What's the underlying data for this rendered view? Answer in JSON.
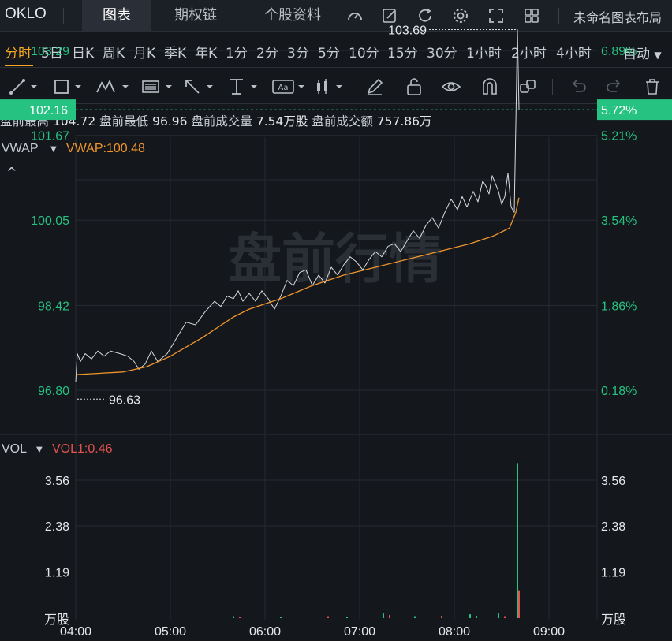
{
  "topbar": {
    "symbol": "OKLO",
    "tabs": [
      "图表",
      "期权链",
      "个股资料"
    ],
    "active_tab": 0,
    "layout_name": "未命名图表布局",
    "icons": [
      "gauge-icon",
      "pencil-edit-icon",
      "refresh-icon",
      "gear-icon",
      "fullscreen-icon",
      "grid-layout-icon"
    ]
  },
  "timeframes": {
    "items": [
      "分时",
      "5日",
      "日K",
      "周K",
      "月K",
      "季K",
      "年K",
      "1分",
      "2分",
      "3分",
      "5分",
      "10分",
      "15分",
      "30分",
      "1小时",
      "2小时",
      "4小时"
    ],
    "active": "分时",
    "scale_mode": "自动"
  },
  "toolbar": {
    "tools": [
      "line-tool-icon",
      "rectangle-tool-icon",
      "pattern-tool-icon",
      "fib-tool-icon",
      "arrow-tool-icon",
      "measure-tool-icon",
      "text-tool-icon",
      "candle-tool-icon",
      "brush-icon",
      "unlock-icon",
      "eye-icon",
      "magnet-icon",
      "clone-icon",
      "undo-icon",
      "redo-icon",
      "trash-icon"
    ]
  },
  "info": {
    "premarket_high_label": "盘前最高",
    "premarket_high": "104.72",
    "premarket_low_label": "盘前最低",
    "premarket_low": "96.96",
    "premarket_volume_label": "盘前成交量",
    "premarket_volume": "7.54万股",
    "premarket_turnover_label": "盘前成交额",
    "premarket_turnover": "757.86万"
  },
  "colors": {
    "bg": "#14171c",
    "grid": "#262a32",
    "price_line": "#d8dade",
    "vwap_line": "#f0962b",
    "up": "#26c281",
    "down": "#e2524f",
    "axis_green": "#26c281",
    "vwap_label": "#f0962b",
    "vol_label": "#e2524f"
  },
  "watermark": "盘前行情",
  "chart_data": [
    {
      "type": "line",
      "indicator": "VWAP",
      "indicator_value_label": "VWAP:100.48",
      "collapse_glyph": "^",
      "y_left_ticks": [
        "103.29",
        "101.67",
        "100.05",
        "98.42",
        "96.80"
      ],
      "y_right_ticks": [
        "6.89%",
        "5.21%",
        "3.54%",
        "1.86%",
        "0.18%"
      ],
      "current_price": "102.16",
      "current_change": "5.72%",
      "marked_high": "103.69",
      "marked_low": "96.63",
      "ylim": [
        95.5,
        104.9
      ],
      "xlim": [
        0,
        300
      ],
      "series": [
        {
          "name": "price",
          "x": [
            0,
            1,
            3,
            6,
            10,
            14,
            18,
            22,
            28,
            33,
            37,
            40,
            44,
            48,
            52,
            58,
            64,
            70,
            76,
            82,
            88,
            92,
            96,
            100,
            103,
            106,
            110,
            114,
            118,
            122,
            126,
            130,
            134,
            138,
            142,
            146,
            150,
            154,
            158,
            162,
            166,
            170,
            174,
            178,
            182,
            186,
            190,
            194,
            198,
            202,
            206,
            210,
            214,
            218,
            222,
            226,
            230,
            234,
            238,
            242,
            245,
            248,
            252,
            255,
            258,
            260,
            262,
            264,
            266,
            268,
            270,
            272,
            274,
            276,
            278,
            279,
            280,
            281
          ],
          "y": [
            96.96,
            97.5,
            97.35,
            97.5,
            97.4,
            97.55,
            97.45,
            97.55,
            97.5,
            97.45,
            97.35,
            97.2,
            97.3,
            97.55,
            97.35,
            97.5,
            97.8,
            98.1,
            98.05,
            98.3,
            98.5,
            98.4,
            98.6,
            98.55,
            98.7,
            98.5,
            98.65,
            98.5,
            98.7,
            98.55,
            98.35,
            98.6,
            98.9,
            98.8,
            99.05,
            99.1,
            98.8,
            99.0,
            98.85,
            99.15,
            99.0,
            99.2,
            99.35,
            99.25,
            99.1,
            99.3,
            99.45,
            99.35,
            99.55,
            99.6,
            99.45,
            99.65,
            99.85,
            99.7,
            99.95,
            100.1,
            99.9,
            100.2,
            100.45,
            100.25,
            100.5,
            100.3,
            100.6,
            100.4,
            100.8,
            100.7,
            100.55,
            100.9,
            100.75,
            100.6,
            100.35,
            100.5,
            100.95,
            100.3,
            100.2,
            101.9,
            103.69,
            102.16
          ]
        },
        {
          "name": "VWAP",
          "x": [
            0,
            30,
            45,
            60,
            80,
            100,
            110,
            130,
            150,
            170,
            190,
            210,
            230,
            250,
            265,
            275,
            279,
            281
          ],
          "y": [
            97.1,
            97.15,
            97.25,
            97.45,
            97.8,
            98.2,
            98.35,
            98.55,
            98.8,
            99.0,
            99.15,
            99.3,
            99.45,
            99.6,
            99.75,
            99.9,
            100.2,
            100.48
          ]
        }
      ]
    },
    {
      "type": "bar",
      "indicator": "VOL",
      "indicator_value_label": "VOL1:0.46",
      "y_ticks": [
        "3.56",
        "2.38",
        "1.19"
      ],
      "y_unit": "万股",
      "x_ticks": [
        "04:00",
        "05:00",
        "06:00",
        "07:00",
        "08:00",
        "09:00"
      ],
      "ylim": [
        0,
        4.3
      ],
      "bars": [
        {
          "x": 100,
          "v": 0.05,
          "up": true
        },
        {
          "x": 104,
          "v": 0.03,
          "up": false
        },
        {
          "x": 130,
          "v": 0.04,
          "up": true
        },
        {
          "x": 160,
          "v": 0.05,
          "up": false
        },
        {
          "x": 172,
          "v": 0.04,
          "up": true
        },
        {
          "x": 195,
          "v": 0.12,
          "up": true
        },
        {
          "x": 199,
          "v": 0.08,
          "up": false
        },
        {
          "x": 215,
          "v": 0.05,
          "up": true
        },
        {
          "x": 232,
          "v": 0.06,
          "up": false
        },
        {
          "x": 250,
          "v": 0.1,
          "up": true
        },
        {
          "x": 254,
          "v": 0.06,
          "up": true
        },
        {
          "x": 268,
          "v": 0.12,
          "up": true
        },
        {
          "x": 272,
          "v": 0.05,
          "up": false
        },
        {
          "x": 280,
          "v": 4.0,
          "up": true
        },
        {
          "x": 281,
          "v": 0.72,
          "up": false
        }
      ]
    }
  ]
}
